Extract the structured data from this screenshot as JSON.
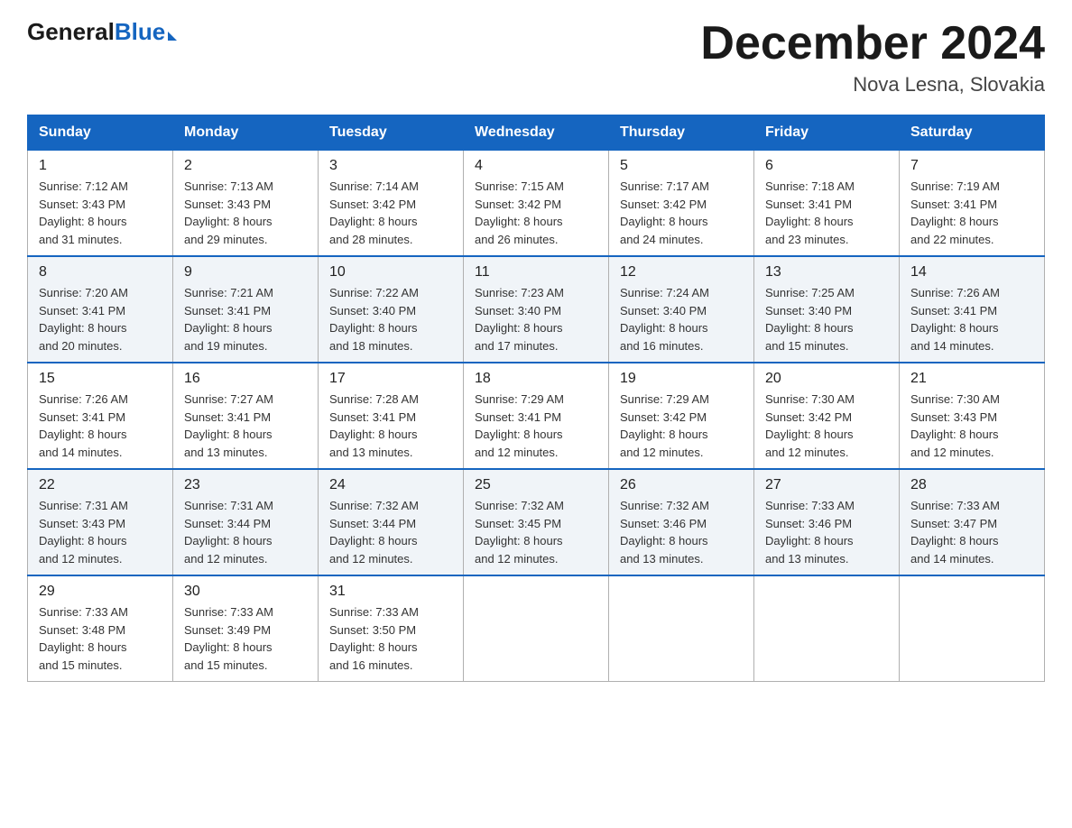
{
  "header": {
    "logo": {
      "general": "General",
      "blue": "Blue"
    },
    "title": "December 2024",
    "location": "Nova Lesna, Slovakia"
  },
  "days_of_week": [
    "Sunday",
    "Monday",
    "Tuesday",
    "Wednesday",
    "Thursday",
    "Friday",
    "Saturday"
  ],
  "weeks": [
    [
      {
        "day": "1",
        "sunrise": "7:12 AM",
        "sunset": "3:43 PM",
        "daylight": "8 hours and 31 minutes."
      },
      {
        "day": "2",
        "sunrise": "7:13 AM",
        "sunset": "3:43 PM",
        "daylight": "8 hours and 29 minutes."
      },
      {
        "day": "3",
        "sunrise": "7:14 AM",
        "sunset": "3:42 PM",
        "daylight": "8 hours and 28 minutes."
      },
      {
        "day": "4",
        "sunrise": "7:15 AM",
        "sunset": "3:42 PM",
        "daylight": "8 hours and 26 minutes."
      },
      {
        "day": "5",
        "sunrise": "7:17 AM",
        "sunset": "3:42 PM",
        "daylight": "8 hours and 24 minutes."
      },
      {
        "day": "6",
        "sunrise": "7:18 AM",
        "sunset": "3:41 PM",
        "daylight": "8 hours and 23 minutes."
      },
      {
        "day": "7",
        "sunrise": "7:19 AM",
        "sunset": "3:41 PM",
        "daylight": "8 hours and 22 minutes."
      }
    ],
    [
      {
        "day": "8",
        "sunrise": "7:20 AM",
        "sunset": "3:41 PM",
        "daylight": "8 hours and 20 minutes."
      },
      {
        "day": "9",
        "sunrise": "7:21 AM",
        "sunset": "3:41 PM",
        "daylight": "8 hours and 19 minutes."
      },
      {
        "day": "10",
        "sunrise": "7:22 AM",
        "sunset": "3:40 PM",
        "daylight": "8 hours and 18 minutes."
      },
      {
        "day": "11",
        "sunrise": "7:23 AM",
        "sunset": "3:40 PM",
        "daylight": "8 hours and 17 minutes."
      },
      {
        "day": "12",
        "sunrise": "7:24 AM",
        "sunset": "3:40 PM",
        "daylight": "8 hours and 16 minutes."
      },
      {
        "day": "13",
        "sunrise": "7:25 AM",
        "sunset": "3:40 PM",
        "daylight": "8 hours and 15 minutes."
      },
      {
        "day": "14",
        "sunrise": "7:26 AM",
        "sunset": "3:41 PM",
        "daylight": "8 hours and 14 minutes."
      }
    ],
    [
      {
        "day": "15",
        "sunrise": "7:26 AM",
        "sunset": "3:41 PM",
        "daylight": "8 hours and 14 minutes."
      },
      {
        "day": "16",
        "sunrise": "7:27 AM",
        "sunset": "3:41 PM",
        "daylight": "8 hours and 13 minutes."
      },
      {
        "day": "17",
        "sunrise": "7:28 AM",
        "sunset": "3:41 PM",
        "daylight": "8 hours and 13 minutes."
      },
      {
        "day": "18",
        "sunrise": "7:29 AM",
        "sunset": "3:41 PM",
        "daylight": "8 hours and 12 minutes."
      },
      {
        "day": "19",
        "sunrise": "7:29 AM",
        "sunset": "3:42 PM",
        "daylight": "8 hours and 12 minutes."
      },
      {
        "day": "20",
        "sunrise": "7:30 AM",
        "sunset": "3:42 PM",
        "daylight": "8 hours and 12 minutes."
      },
      {
        "day": "21",
        "sunrise": "7:30 AM",
        "sunset": "3:43 PM",
        "daylight": "8 hours and 12 minutes."
      }
    ],
    [
      {
        "day": "22",
        "sunrise": "7:31 AM",
        "sunset": "3:43 PM",
        "daylight": "8 hours and 12 minutes."
      },
      {
        "day": "23",
        "sunrise": "7:31 AM",
        "sunset": "3:44 PM",
        "daylight": "8 hours and 12 minutes."
      },
      {
        "day": "24",
        "sunrise": "7:32 AM",
        "sunset": "3:44 PM",
        "daylight": "8 hours and 12 minutes."
      },
      {
        "day": "25",
        "sunrise": "7:32 AM",
        "sunset": "3:45 PM",
        "daylight": "8 hours and 12 minutes."
      },
      {
        "day": "26",
        "sunrise": "7:32 AM",
        "sunset": "3:46 PM",
        "daylight": "8 hours and 13 minutes."
      },
      {
        "day": "27",
        "sunrise": "7:33 AM",
        "sunset": "3:46 PM",
        "daylight": "8 hours and 13 minutes."
      },
      {
        "day": "28",
        "sunrise": "7:33 AM",
        "sunset": "3:47 PM",
        "daylight": "8 hours and 14 minutes."
      }
    ],
    [
      {
        "day": "29",
        "sunrise": "7:33 AM",
        "sunset": "3:48 PM",
        "daylight": "8 hours and 15 minutes."
      },
      {
        "day": "30",
        "sunrise": "7:33 AM",
        "sunset": "3:49 PM",
        "daylight": "8 hours and 15 minutes."
      },
      {
        "day": "31",
        "sunrise": "7:33 AM",
        "sunset": "3:50 PM",
        "daylight": "8 hours and 16 minutes."
      },
      null,
      null,
      null,
      null
    ]
  ],
  "labels": {
    "sunrise": "Sunrise:",
    "sunset": "Sunset:",
    "daylight": "Daylight:"
  }
}
